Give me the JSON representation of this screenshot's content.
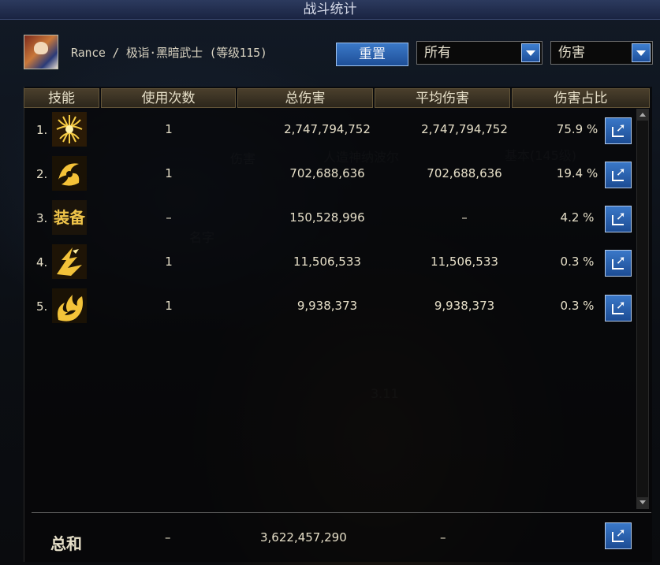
{
  "window": {
    "title": "战斗统计"
  },
  "header": {
    "character": "Rance / 极诣·黑暗武士 (等级115)",
    "reset_label": "重置",
    "filter_select": "所有",
    "metric_select": "伤害"
  },
  "table": {
    "columns": [
      "技能",
      "使用次数",
      "总伤害",
      "平均伤害",
      "伤害占比"
    ],
    "rows": [
      {
        "index": "1.",
        "icon": "skill-icon-radiant",
        "skill_text": "",
        "uses": "1",
        "total": "2,747,794,752",
        "average": "2,747,794,752",
        "share": "75.9 %"
      },
      {
        "index": "2.",
        "icon": "skill-icon-vortex",
        "skill_text": "",
        "uses": "1",
        "total": "702,688,636",
        "average": "702,688,636",
        "share": "19.4 %"
      },
      {
        "index": "3.",
        "icon": "equipment-text-icon",
        "skill_text": "装备",
        "uses": "–",
        "total": "150,528,996",
        "average": "–",
        "share": "4.2 %"
      },
      {
        "index": "4.",
        "icon": "skill-icon-dragon",
        "skill_text": "",
        "uses": "1",
        "total": "11,506,533",
        "average": "11,506,533",
        "share": "0.3 %"
      },
      {
        "index": "5.",
        "icon": "skill-icon-flame",
        "skill_text": "",
        "uses": "1",
        "total": "9,938,373",
        "average": "9,938,373",
        "share": "0.3 %"
      }
    ]
  },
  "footer": {
    "total_label": "总和",
    "uses": "–",
    "total": "3,622,457,290",
    "average": "–"
  },
  "colors": {
    "title_bar": "#1f2a4a",
    "header_cell": "#3a3122",
    "button_blue": "#2a63b0",
    "gold_icon": "#f2c23a"
  }
}
